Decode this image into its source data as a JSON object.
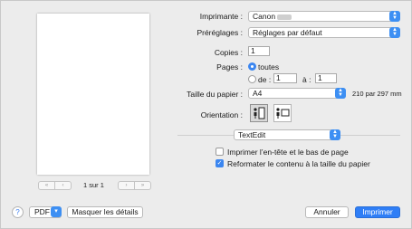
{
  "preview": {
    "page_indicator": "1 sur 1",
    "nav_first": "«",
    "nav_prev": "‹",
    "nav_next": "›",
    "nav_last": "»"
  },
  "printer": {
    "label": "Imprimante :",
    "value": "Canon"
  },
  "presets": {
    "label": "Préréglages :",
    "value": "Réglages par défaut"
  },
  "copies": {
    "label": "Copies :",
    "value": "1"
  },
  "pages": {
    "label": "Pages :",
    "all_label": "toutes",
    "from_label": "de :",
    "from_value": "1",
    "to_label": "à :",
    "to_value": "1"
  },
  "paper": {
    "label": "Taille du papier :",
    "value": "A4",
    "size_text": "210 par 297 mm"
  },
  "orientation": {
    "label": "Orientation :"
  },
  "app_menu": {
    "value": "TextEdit"
  },
  "options": {
    "header_footer": {
      "label": "Imprimer l’en-tête et le bas de page",
      "checked": false
    },
    "rewrap": {
      "label": "Reformater le contenu à la taille du papier",
      "checked": true
    }
  },
  "footer": {
    "help": "?",
    "pdf_label": "PDF",
    "hide_details": "Masquer les détails",
    "cancel": "Annuler",
    "print": "Imprimer"
  },
  "colors": {
    "accent": "#3b86f0",
    "primary_button": "#2f7ef6"
  }
}
